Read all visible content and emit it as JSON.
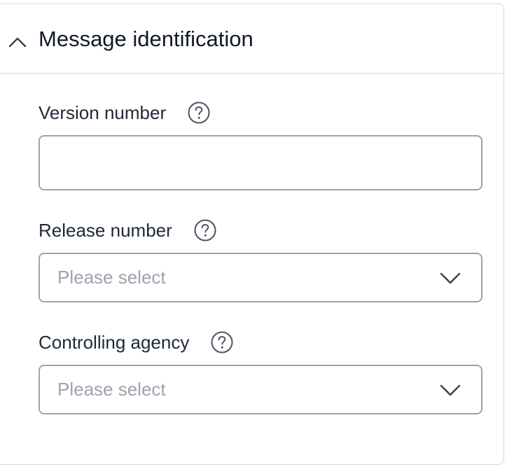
{
  "section": {
    "title": "Message identification",
    "expanded": true,
    "icon": "chevron-up-icon"
  },
  "fields": {
    "version_number": {
      "label": "Version number",
      "value": "",
      "help_icon": "question-circle-icon"
    },
    "release_number": {
      "label": "Release number",
      "selected": "Please select",
      "help_icon": "question-circle-icon",
      "dropdown_icon": "chevron-down-icon"
    },
    "controlling_agency": {
      "label": "Controlling agency",
      "selected": "Please select",
      "help_icon": "question-circle-icon",
      "dropdown_icon": "chevron-down-icon"
    }
  },
  "colors": {
    "border": "#d1d5db",
    "input_border": "#9ca3af",
    "placeholder": "#9ca3af",
    "text": "#1f2937",
    "icon": "#6b7280"
  }
}
